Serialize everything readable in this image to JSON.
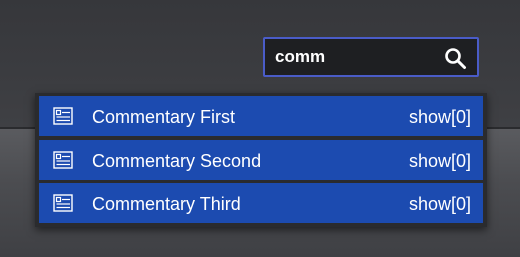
{
  "search": {
    "value": "comm",
    "icon": "search-icon"
  },
  "dropdown": {
    "items": [
      {
        "label": "Commentary First",
        "action": "show[0]",
        "icon": "document-list-icon"
      },
      {
        "label": "Commentary Second",
        "action": "show[0]",
        "icon": "document-list-icon"
      },
      {
        "label": "Commentary Third",
        "action": "show[0]",
        "icon": "document-list-icon"
      }
    ]
  },
  "colors": {
    "background": "#3a3b3f",
    "search_border": "#4a5cc8",
    "item_background": "#1c4bb0",
    "text": "#ffffff"
  }
}
